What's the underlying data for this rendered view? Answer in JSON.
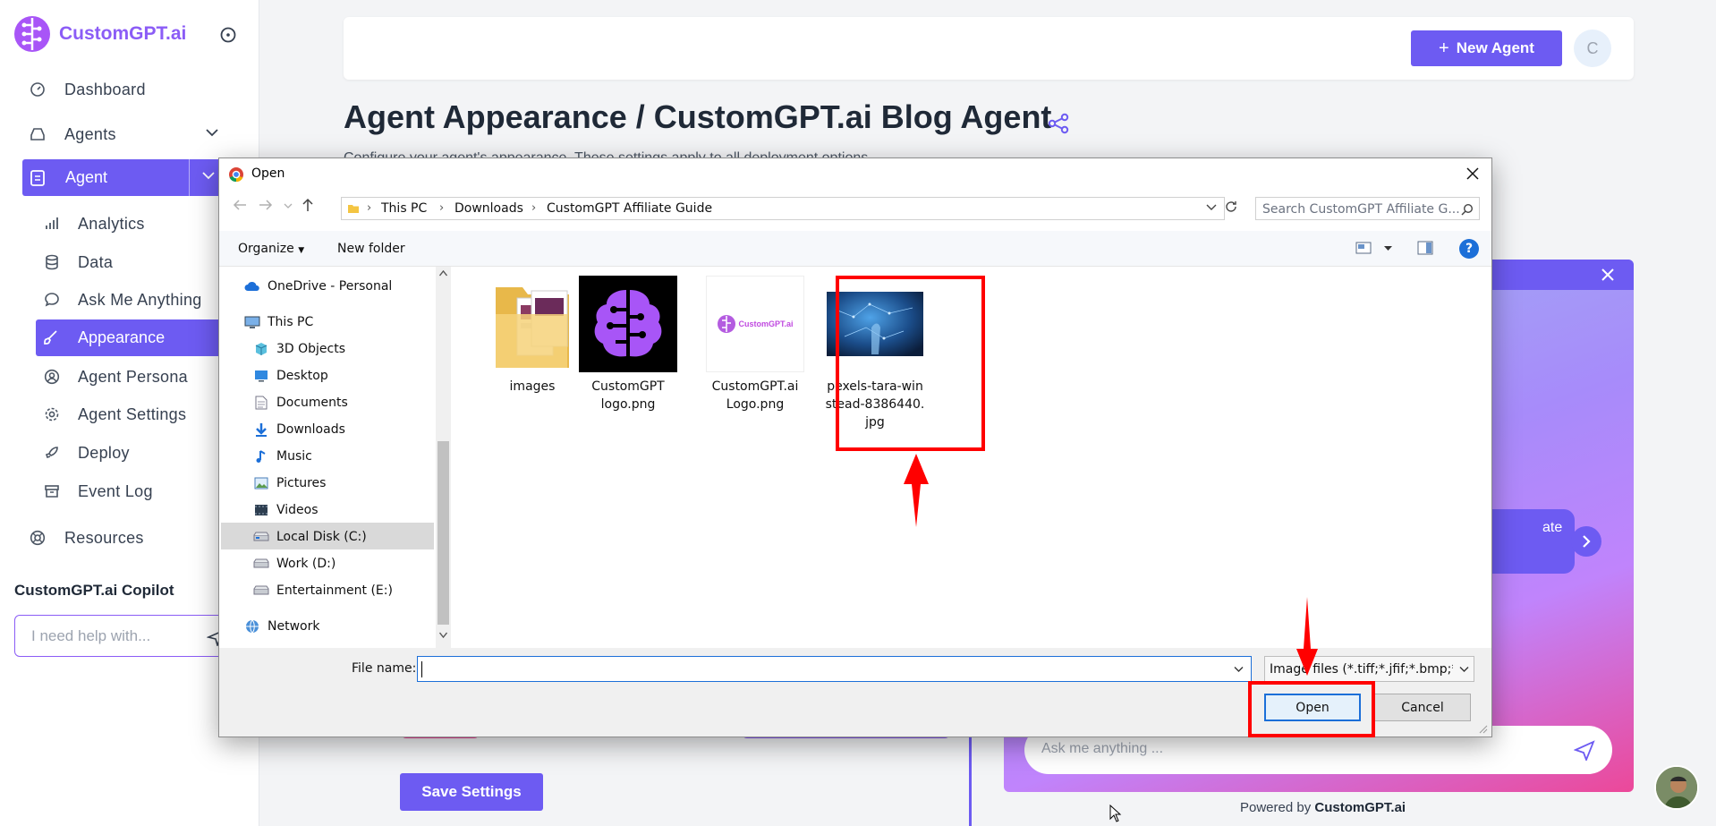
{
  "sidebar": {
    "brand": "CustomGPT.ai",
    "items": [
      {
        "label": "Dashboard"
      },
      {
        "label": "Agents"
      },
      {
        "label": "Agent"
      },
      {
        "label": "Analytics"
      },
      {
        "label": "Data"
      },
      {
        "label": "Ask Me Anything"
      },
      {
        "label": "Appearance"
      },
      {
        "label": "Agent Persona"
      },
      {
        "label": "Agent Settings"
      },
      {
        "label": "Deploy"
      },
      {
        "label": "Event Log"
      },
      {
        "label": "Resources"
      }
    ],
    "copilot_title": "CustomGPT.ai Copilot",
    "copilot_placeholder": "I need help with..."
  },
  "header": {
    "new_agent": "New Agent",
    "avatar_initial": "C"
  },
  "page": {
    "title": "Agent Appearance / CustomGPT.ai Blog Agent",
    "subtitle": "Configure your agent's appearance. These settings apply to all deployment options.",
    "save_button": "Save Settings"
  },
  "preview": {
    "bubble_text": "ate",
    "input_placeholder": "Ask me anything ...",
    "powered_prefix": "Powered by ",
    "powered_brand": "CustomGPT.ai"
  },
  "dialog": {
    "title": "Open",
    "breadcrumb": [
      "This PC",
      "Downloads",
      "CustomGPT Affiliate Guide"
    ],
    "search_placeholder": "Search CustomGPT Affiliate G...",
    "organize": "Organize",
    "new_folder": "New folder",
    "help": "?",
    "tree": [
      {
        "label": "OneDrive - Personal",
        "icon": "cloud-icon"
      },
      {
        "label": "This PC",
        "icon": "computer-icon"
      },
      {
        "label": "3D Objects",
        "icon": "cube-icon"
      },
      {
        "label": "Desktop",
        "icon": "desktop-icon"
      },
      {
        "label": "Documents",
        "icon": "document-icon"
      },
      {
        "label": "Downloads",
        "icon": "download-icon"
      },
      {
        "label": "Music",
        "icon": "music-icon"
      },
      {
        "label": "Pictures",
        "icon": "pictures-icon"
      },
      {
        "label": "Videos",
        "icon": "video-icon"
      },
      {
        "label": "Local Disk (C:)",
        "icon": "drive-icon"
      },
      {
        "label": "Work (D:)",
        "icon": "drive-icon"
      },
      {
        "label": "Entertainment (E:)",
        "icon": "drive-icon"
      },
      {
        "label": "Network",
        "icon": "network-icon"
      }
    ],
    "files": [
      {
        "name": "images"
      },
      {
        "name": "CustomGPT logo.png"
      },
      {
        "name": "CustomGPT.ai Logo.png",
        "logo_text": "CustomGPT.ai"
      },
      {
        "name": "pexels-tara-winstead-8386440.jpg"
      }
    ],
    "file_name_label": "File name:",
    "file_name_value": "",
    "filter": "Image files (*.tiff;*.jfif;*.bmp;*.p",
    "open": "Open",
    "cancel": "Cancel"
  },
  "colors": {
    "accent": "#6d5bf2",
    "annotation": "#ff0000"
  }
}
